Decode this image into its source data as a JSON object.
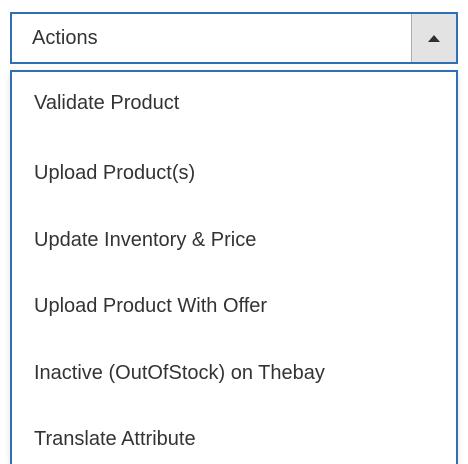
{
  "dropdown": {
    "label": "Actions",
    "toggle_icon": "caret-up-icon"
  },
  "menu": {
    "items": [
      {
        "label": "Validate Product"
      },
      {
        "label": "Upload Product(s)"
      },
      {
        "label": "Update Inventory & Price"
      },
      {
        "label": "Upload Product With Offer"
      },
      {
        "label": "Inactive (OutOfStock) on Thebay"
      },
      {
        "label": "Translate Attribute"
      }
    ]
  },
  "colors": {
    "border": "#2f6fb3",
    "button_bg": "#e3e3e3",
    "text": "#333333"
  }
}
